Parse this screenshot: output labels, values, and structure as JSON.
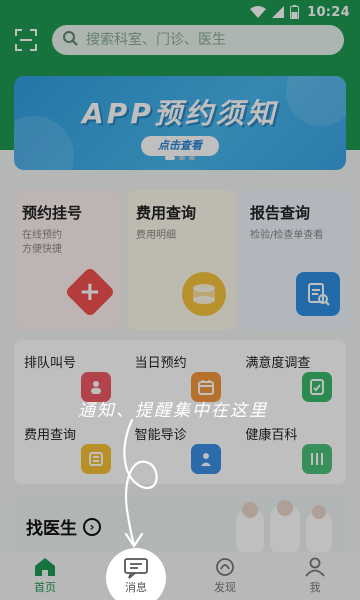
{
  "status": {
    "time": "10:24",
    "battery_level": 0.55
  },
  "search": {
    "placeholder": "搜索科室、门诊、医生"
  },
  "banner": {
    "title": "APP预约须知",
    "cta": "点击查看",
    "page_count": 3,
    "active_page": 1
  },
  "cards": [
    {
      "title": "预约挂号",
      "subtitle": "在线预约\n方便快捷",
      "icon": "plus-icon"
    },
    {
      "title": "费用查询",
      "subtitle": "费用明细",
      "icon": "coins-icon"
    },
    {
      "title": "报告查询",
      "subtitle": "检验/检查单查看",
      "icon": "report-icon"
    }
  ],
  "grid": [
    {
      "label": "排队叫号",
      "icon": "queue-icon"
    },
    {
      "label": "当日预约",
      "icon": "calendar-icon"
    },
    {
      "label": "满意度调查",
      "icon": "survey-icon"
    },
    {
      "label": "费用查询",
      "icon": "bill-icon"
    },
    {
      "label": "智能导诊",
      "icon": "guide-icon"
    },
    {
      "label": "健康百科",
      "icon": "book-icon"
    }
  ],
  "finddoc": {
    "title": "找医生"
  },
  "overlay": {
    "hint": "通知、提醒集中在这里"
  },
  "nav": [
    {
      "label": "首页",
      "icon": "home-icon",
      "active": true
    },
    {
      "label": "消息",
      "icon": "message-icon",
      "active": false
    },
    {
      "label": "发现",
      "icon": "discover-icon",
      "active": false
    },
    {
      "label": "我",
      "icon": "user-icon",
      "active": false
    }
  ],
  "colors": {
    "brand": "#1e9a52",
    "banner": "#3aa4e6"
  }
}
